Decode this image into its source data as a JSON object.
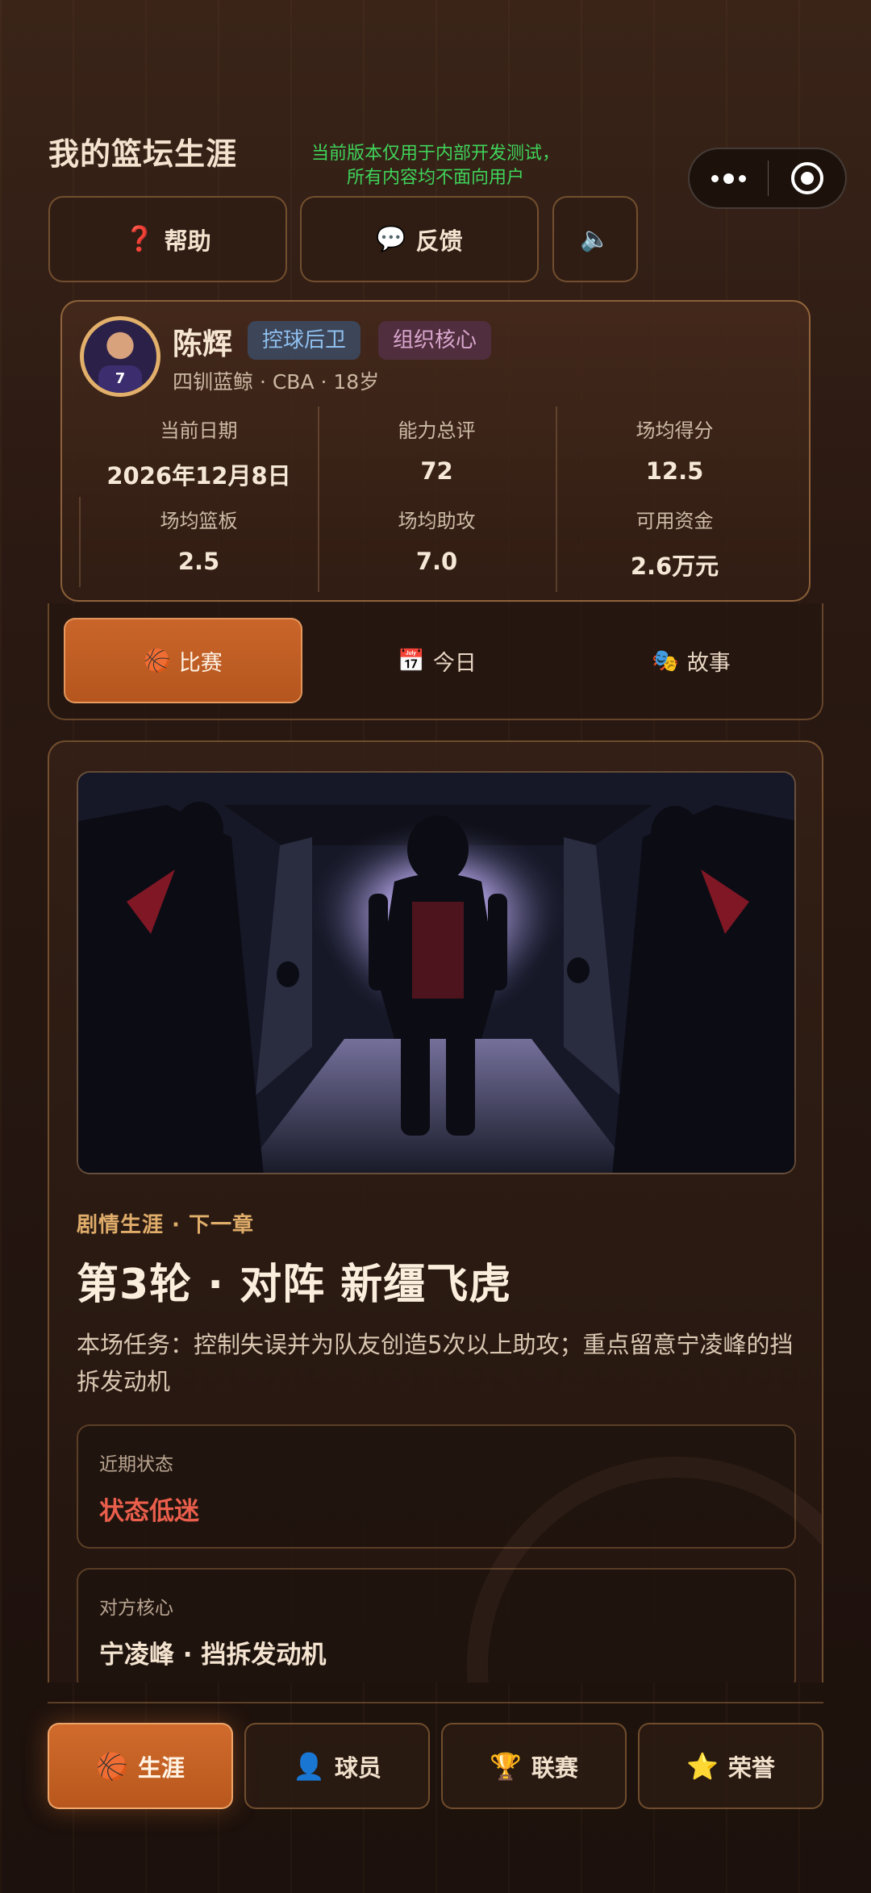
{
  "header": {
    "title": "我的篮坛生涯",
    "dev_notice_line1": "当前版本仅用于内部开发测试，",
    "dev_notice_line2": "所有内容均不面向用户"
  },
  "top_buttons": {
    "help": {
      "icon": "❓",
      "label": "帮助"
    },
    "feedback": {
      "icon": "💬",
      "label": "反馈"
    },
    "sound": {
      "icon": "🔈"
    }
  },
  "player": {
    "name": "陈辉",
    "position_tag": "控球后卫",
    "role_tag": "组织核心",
    "subline": "四钏蓝鲸 · CBA · 18岁",
    "jersey_number": "7",
    "stats": [
      {
        "label": "当前日期",
        "value": "2026年12月8日"
      },
      {
        "label": "能力总评",
        "value": "72"
      },
      {
        "label": "场均得分",
        "value": "12.5"
      },
      {
        "label": "场均篮板",
        "value": "2.5"
      },
      {
        "label": "场均助攻",
        "value": "7.0"
      },
      {
        "label": "可用资金",
        "value": "2.6万元"
      }
    ]
  },
  "tabs": [
    {
      "icon": "🏀",
      "label": "比赛",
      "active": true
    },
    {
      "icon": "📅",
      "label": "今日",
      "active": false
    },
    {
      "icon": "🎭",
      "label": "故事",
      "active": false
    }
  ],
  "match": {
    "kicker": "剧情生涯 · 下一章",
    "title": "第3轮 · 对阵 新缰飞虎",
    "mission": "本场任务：控制失误并为队友创造5次以上助攻；重点留意宁凌峰的挡拆发动机",
    "recent_form_label": "近期状态",
    "recent_form_value": "状态低迷",
    "opponent_core_label": "对方核心",
    "opponent_core_value": "宁凌峰 · 挡拆发动机"
  },
  "bottom_nav": [
    {
      "icon": "🏀",
      "label": "生涯",
      "active": true
    },
    {
      "icon": "👤",
      "label": "球员",
      "active": false
    },
    {
      "icon": "🏆",
      "label": "联赛",
      "active": false
    },
    {
      "icon": "⭐",
      "label": "荣誉",
      "active": false
    }
  ],
  "colors": {
    "accent": "#c9652a",
    "dev_notice": "#3fd35a",
    "warning_state": "#ea5e4c",
    "gold": "#e0ad6a"
  }
}
